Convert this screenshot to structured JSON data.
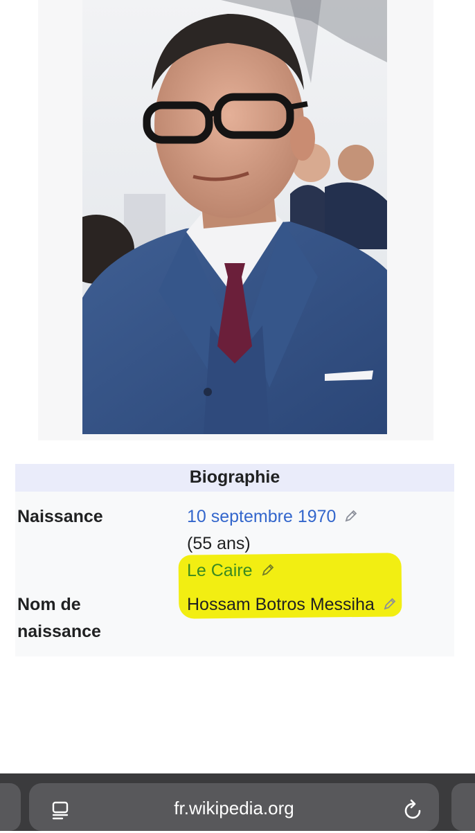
{
  "infobox": {
    "header": "Biographie",
    "rows": [
      {
        "label": "Naissance",
        "date_link": "10 septembre 1970",
        "age": "(55 ans)",
        "place_link": "Le Caire"
      },
      {
        "label_line1": "Nom de",
        "label_line2": "naissance",
        "value": "Hossam Botros Messiha"
      }
    ]
  },
  "browser": {
    "url": "fr.wikipedia.org"
  },
  "colors": {
    "link_blue": "#3366cc",
    "link_green": "#3a8a21",
    "highlight": "#f2ee12",
    "header_bg": "#eaecfa",
    "toolbar_bg": "#3b3b3d"
  }
}
